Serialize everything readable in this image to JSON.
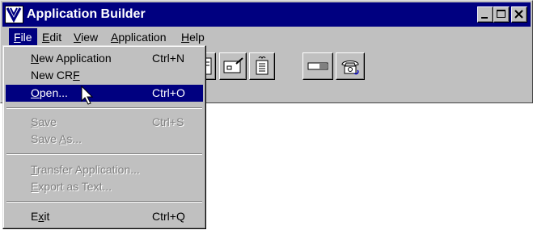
{
  "window": {
    "title": "Application Builder",
    "app_icon": "app-builder-logo-icon",
    "caption_buttons": [
      "minimize-icon",
      "maximize-icon",
      "close-icon"
    ]
  },
  "menubar": {
    "items": [
      {
        "pre": "",
        "ul": "F",
        "post": "ile"
      },
      {
        "pre": "",
        "ul": "E",
        "post": "dit"
      },
      {
        "pre": "",
        "ul": "V",
        "post": "iew"
      },
      {
        "pre": "",
        "ul": "A",
        "post": "pplication"
      },
      {
        "pre": "",
        "ul": "H",
        "post": "elp"
      }
    ],
    "active_index": 0
  },
  "toolbar": {
    "buttons": [
      "document-icon",
      "form-edit-icon",
      "list-document-icon",
      "field-icon",
      "telephone-icon"
    ]
  },
  "file_menu": {
    "new_app": {
      "pre": "",
      "ul": "N",
      "post": "ew Application",
      "shortcut": "Ctrl+N"
    },
    "new_crf": {
      "pre": "New CR",
      "ul": "F",
      "post": "",
      "shortcut": ""
    },
    "open": {
      "pre": "",
      "ul": "O",
      "post": "pen...",
      "shortcut": "Ctrl+O"
    },
    "save": {
      "pre": "",
      "ul": "S",
      "post": "ave",
      "shortcut": "Ctrl+S"
    },
    "save_as": {
      "pre": "Save ",
      "ul": "A",
      "post": "s...",
      "shortcut": ""
    },
    "transfer": {
      "pre": "",
      "ul": "T",
      "post": "ransfer Application...",
      "shortcut": ""
    },
    "export": {
      "pre": "",
      "ul": "E",
      "post": "xport as Text...",
      "shortcut": ""
    },
    "exit": {
      "pre": "E",
      "ul": "x",
      "post": "it",
      "shortcut": "Ctrl+Q"
    }
  },
  "cursor": "arrow-cursor-icon"
}
